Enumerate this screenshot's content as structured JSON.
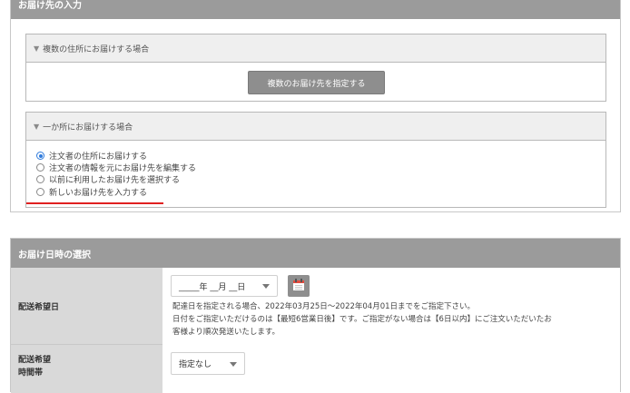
{
  "address_section": {
    "title": "お届け先の入力",
    "multi_panel": {
      "header": "複数の住所にお届けする場合",
      "button_label": "複数のお届け先を指定する"
    },
    "single_panel": {
      "header": "一か所にお届けする場合",
      "options": [
        {
          "label": "注文者の住所にお届けする",
          "checked": true
        },
        {
          "label": "注文者の情報を元にお届け先を編集する",
          "checked": false
        },
        {
          "label": "以前に利用したお届け先を選択する",
          "checked": false
        },
        {
          "label": "新しいお届け先を入力する",
          "checked": false
        }
      ]
    },
    "highlight_color": "#e02020"
  },
  "delivery_section": {
    "title": "お届け日時の選択",
    "date_row": {
      "label": "配送希望日",
      "select_value": "_____年 __月 __日",
      "calendar_icon": "calendar-icon",
      "note_line1": "配達日を指定される場合、2022年03月25日～2022年04月01日までをご指定下さい。",
      "note_line2": "日付をご指定いただけるのは【最短6営業日後】です。ご指定がない場合は【6日以内】にご注文いただいたお",
      "note_line3": "客様より順次発送いたします。"
    },
    "time_row": {
      "label_line1": "配送希望",
      "label_line2": "時間帯",
      "select_value": "指定なし"
    }
  },
  "colors": {
    "header_bg": "#9b9b9b",
    "button_bg": "#8e8e8e",
    "radio_accent": "#2f7bdc"
  }
}
